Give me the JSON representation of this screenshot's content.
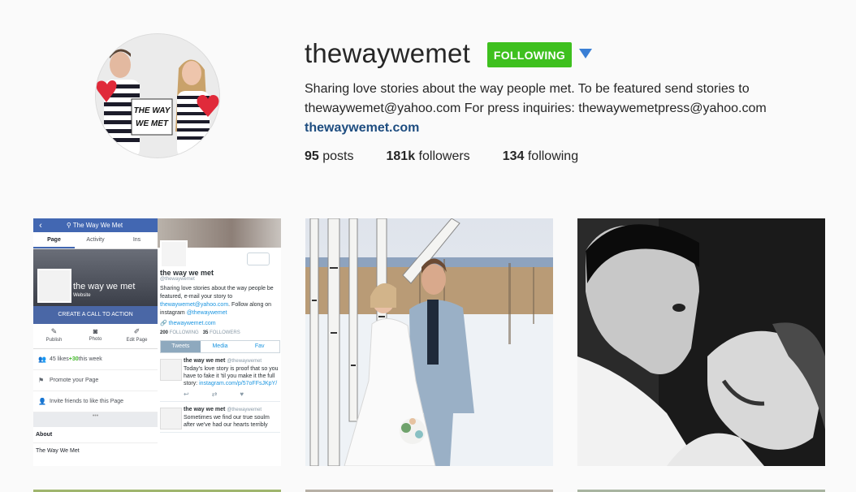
{
  "profile": {
    "username": "thewaywemet",
    "follow_label": "FOLLOWING",
    "bio_text": "Sharing love stories about the way people met. To be featured send stories to thewaywemet@yahoo.com For press inquiries: thewaywemetpress@yahoo.com",
    "website": "thewaywemet.com",
    "avatar_sign": [
      "THE WAY",
      "WE MET"
    ],
    "stats": {
      "posts_count": "95",
      "posts_label": "posts",
      "followers_count": "181k",
      "followers_label": "followers",
      "following_count": "134",
      "following_label": "following"
    }
  },
  "colors": {
    "follow_green": "#3ec01e",
    "dropdown_blue": "#3a7fd5",
    "link_blue": "#1e4d80"
  },
  "posts": [
    {
      "kind": "screenshot-collage",
      "facebook": {
        "header_title": "The Way We Met",
        "tabs": [
          "Page",
          "Activity",
          "Ins"
        ],
        "page_name": "the way we met",
        "page_category": "Website",
        "cta": "CREATE A CALL TO ACTION",
        "actions": [
          "Publish",
          "Photo",
          "Edit Page"
        ],
        "likes_prefix": "45 likes ",
        "likes_delta": "+30",
        "likes_suffix": " this week",
        "promote": "Promote your Page",
        "invite": "Invite friends to like this Page",
        "about_heading": "About",
        "about_name": "The Way We Met"
      },
      "twitter": {
        "name": "the way we met",
        "handle": "@thewaywemet",
        "bio_part1": "Sharing love stories about the way people be featured, e-mail your story to ",
        "bio_email": "thewaywemet@yahoo.com",
        "bio_part2": ". Follow along on instagram ",
        "bio_ig": "@thewaywemet",
        "link": "thewaywemet.com",
        "following_count": "200",
        "following_label": "FOLLOWING",
        "followers_count": "35",
        "followers_label": "FOLLOWERS",
        "tabs": [
          "Tweets",
          "Media",
          "Fav"
        ],
        "tweet1_text": "Today's love story is proof that so you have to fake it 'til you make it the full story: ",
        "tweet1_link": "instagram.com/p/57oFFsJKpY/",
        "tweet2_text": "Sometimes we find our true soulm after we've had our hearts terribly"
      }
    },
    {
      "kind": "photo",
      "subject": "wedding-couple-birch-trees"
    },
    {
      "kind": "photo",
      "subject": "black-and-white-couple-laughing"
    }
  ]
}
